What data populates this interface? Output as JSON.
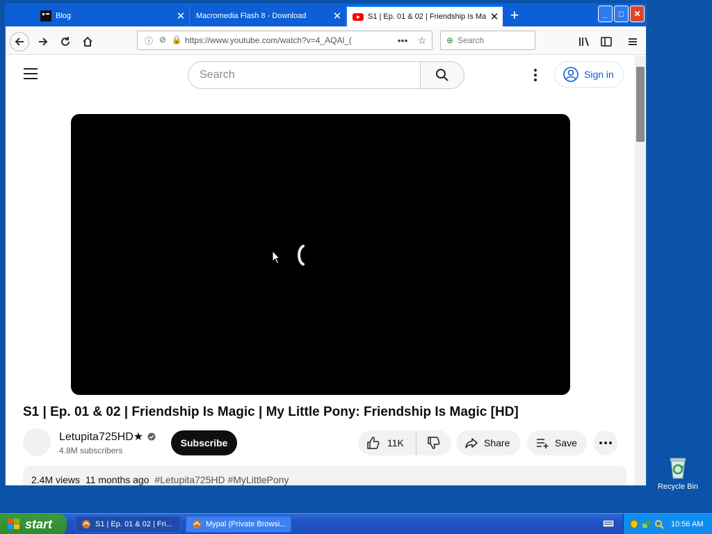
{
  "browser": {
    "tabs": [
      {
        "label": "Blog",
        "active": false
      },
      {
        "label": "Macromedia Flash 8 - Download",
        "active": false
      },
      {
        "label": "S1 | Ep. 01 & 02 | Friendship Is Ma",
        "active": true
      }
    ],
    "url": "https://www.youtube.com/watch?v=4_AQAl_(",
    "search_placeholder": "Search"
  },
  "youtube": {
    "search_placeholder": "Search",
    "sign_in": "Sign in",
    "video_title": "S1 | Ep. 01 & 02 | Friendship Is Magic | My Little Pony: Friendship Is Magic [HD]",
    "channel_name": "Letupita725HD★",
    "subscribers": "4.8M subscribers",
    "subscribe_label": "Subscribe",
    "like_count": "11K",
    "share_label": "Share",
    "save_label": "Save",
    "views": "2.4M views",
    "age": "11 months ago",
    "tags": "#Letupita725HD #MyLittlePony"
  },
  "desktop": {
    "recycle_bin": "Recycle Bin"
  },
  "taskbar": {
    "start_label": "start",
    "items": [
      {
        "label": "S1 | Ep. 01 & 02 | Fri...",
        "active": true
      },
      {
        "label": "Mypal (Private Browsi...",
        "active": false
      }
    ],
    "clock": "10:56 AM"
  },
  "colors": {
    "tabbar": "#0c5fd6",
    "youtube_red": "#ff0000",
    "signin_blue": "#065fd4",
    "desktop": "#0b53a8"
  }
}
